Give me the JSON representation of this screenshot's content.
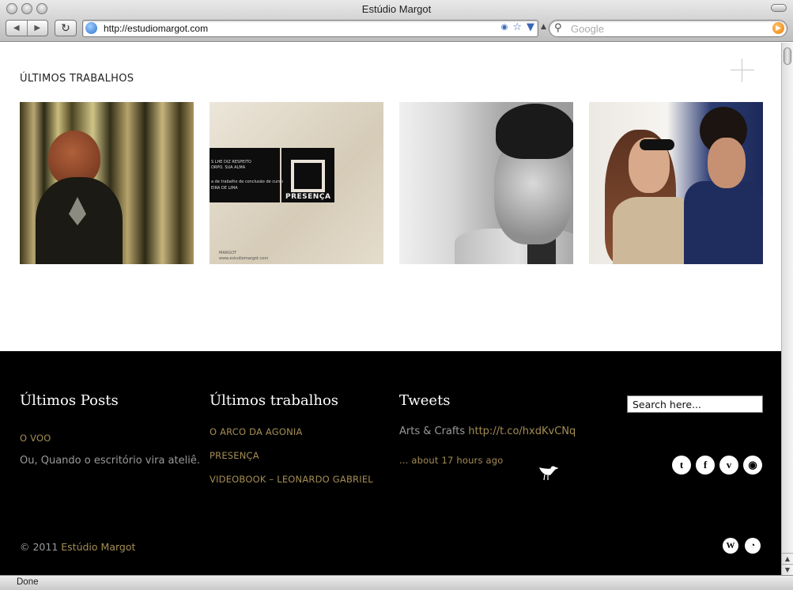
{
  "window": {
    "title": "Estúdio Margot"
  },
  "toolbar": {
    "back_glyph": "◀",
    "forward_glyph": "▶",
    "reload_glyph": "↻",
    "url": "http://estudiomargot.com",
    "search_placeholder": "Google"
  },
  "icons": {
    "rss": "rss-icon",
    "bookmark": "star-icon",
    "dropdown": "chevron-down-icon",
    "search": "magnifier-icon",
    "go": "orange-go-icon"
  },
  "main": {
    "section_title": "ÚLTIMOS TRABALHOS",
    "thumb2": {
      "line1": "S LHE DIZ RESPEITO",
      "line2": "ORPO. SUA ALMA",
      "line3": "a de trabalho de conclusão de curso",
      "line4": "EIRA DE LIMA",
      "title": "PRESENÇA",
      "logo": "MARGOT",
      "site": "www.estudiomargot.com"
    }
  },
  "footer": {
    "posts": {
      "title": "Últimos Posts",
      "link": "O VOO",
      "excerpt": "Ou, Quando o escritório vira ateliê."
    },
    "works": {
      "title": "Últimos trabalhos",
      "items": [
        "O ARCO DA AGONIA",
        "PRESENÇA",
        "VIDEOBOOK – LEONARDO GABRIEL"
      ]
    },
    "tweets": {
      "title": "Tweets",
      "text": "Arts & Crafts ",
      "url": "http://t.co/hxdKvCNq",
      "time": "... about 17 hours ago"
    },
    "search_value": "Search here...",
    "social": {
      "twitter": "t",
      "facebook": "f",
      "vimeo": "v",
      "rss": "◉"
    },
    "copyright_prefix": "© 2011 ",
    "copyright_brand": "Estúdio Margot",
    "bottom_icons": {
      "wordpress": "W",
      "other": "◔"
    }
  },
  "status": {
    "text": "Done"
  },
  "colors": {
    "accent": "#a48d53",
    "footer_bg": "#000000",
    "muted_text": "#9a9a9a"
  }
}
